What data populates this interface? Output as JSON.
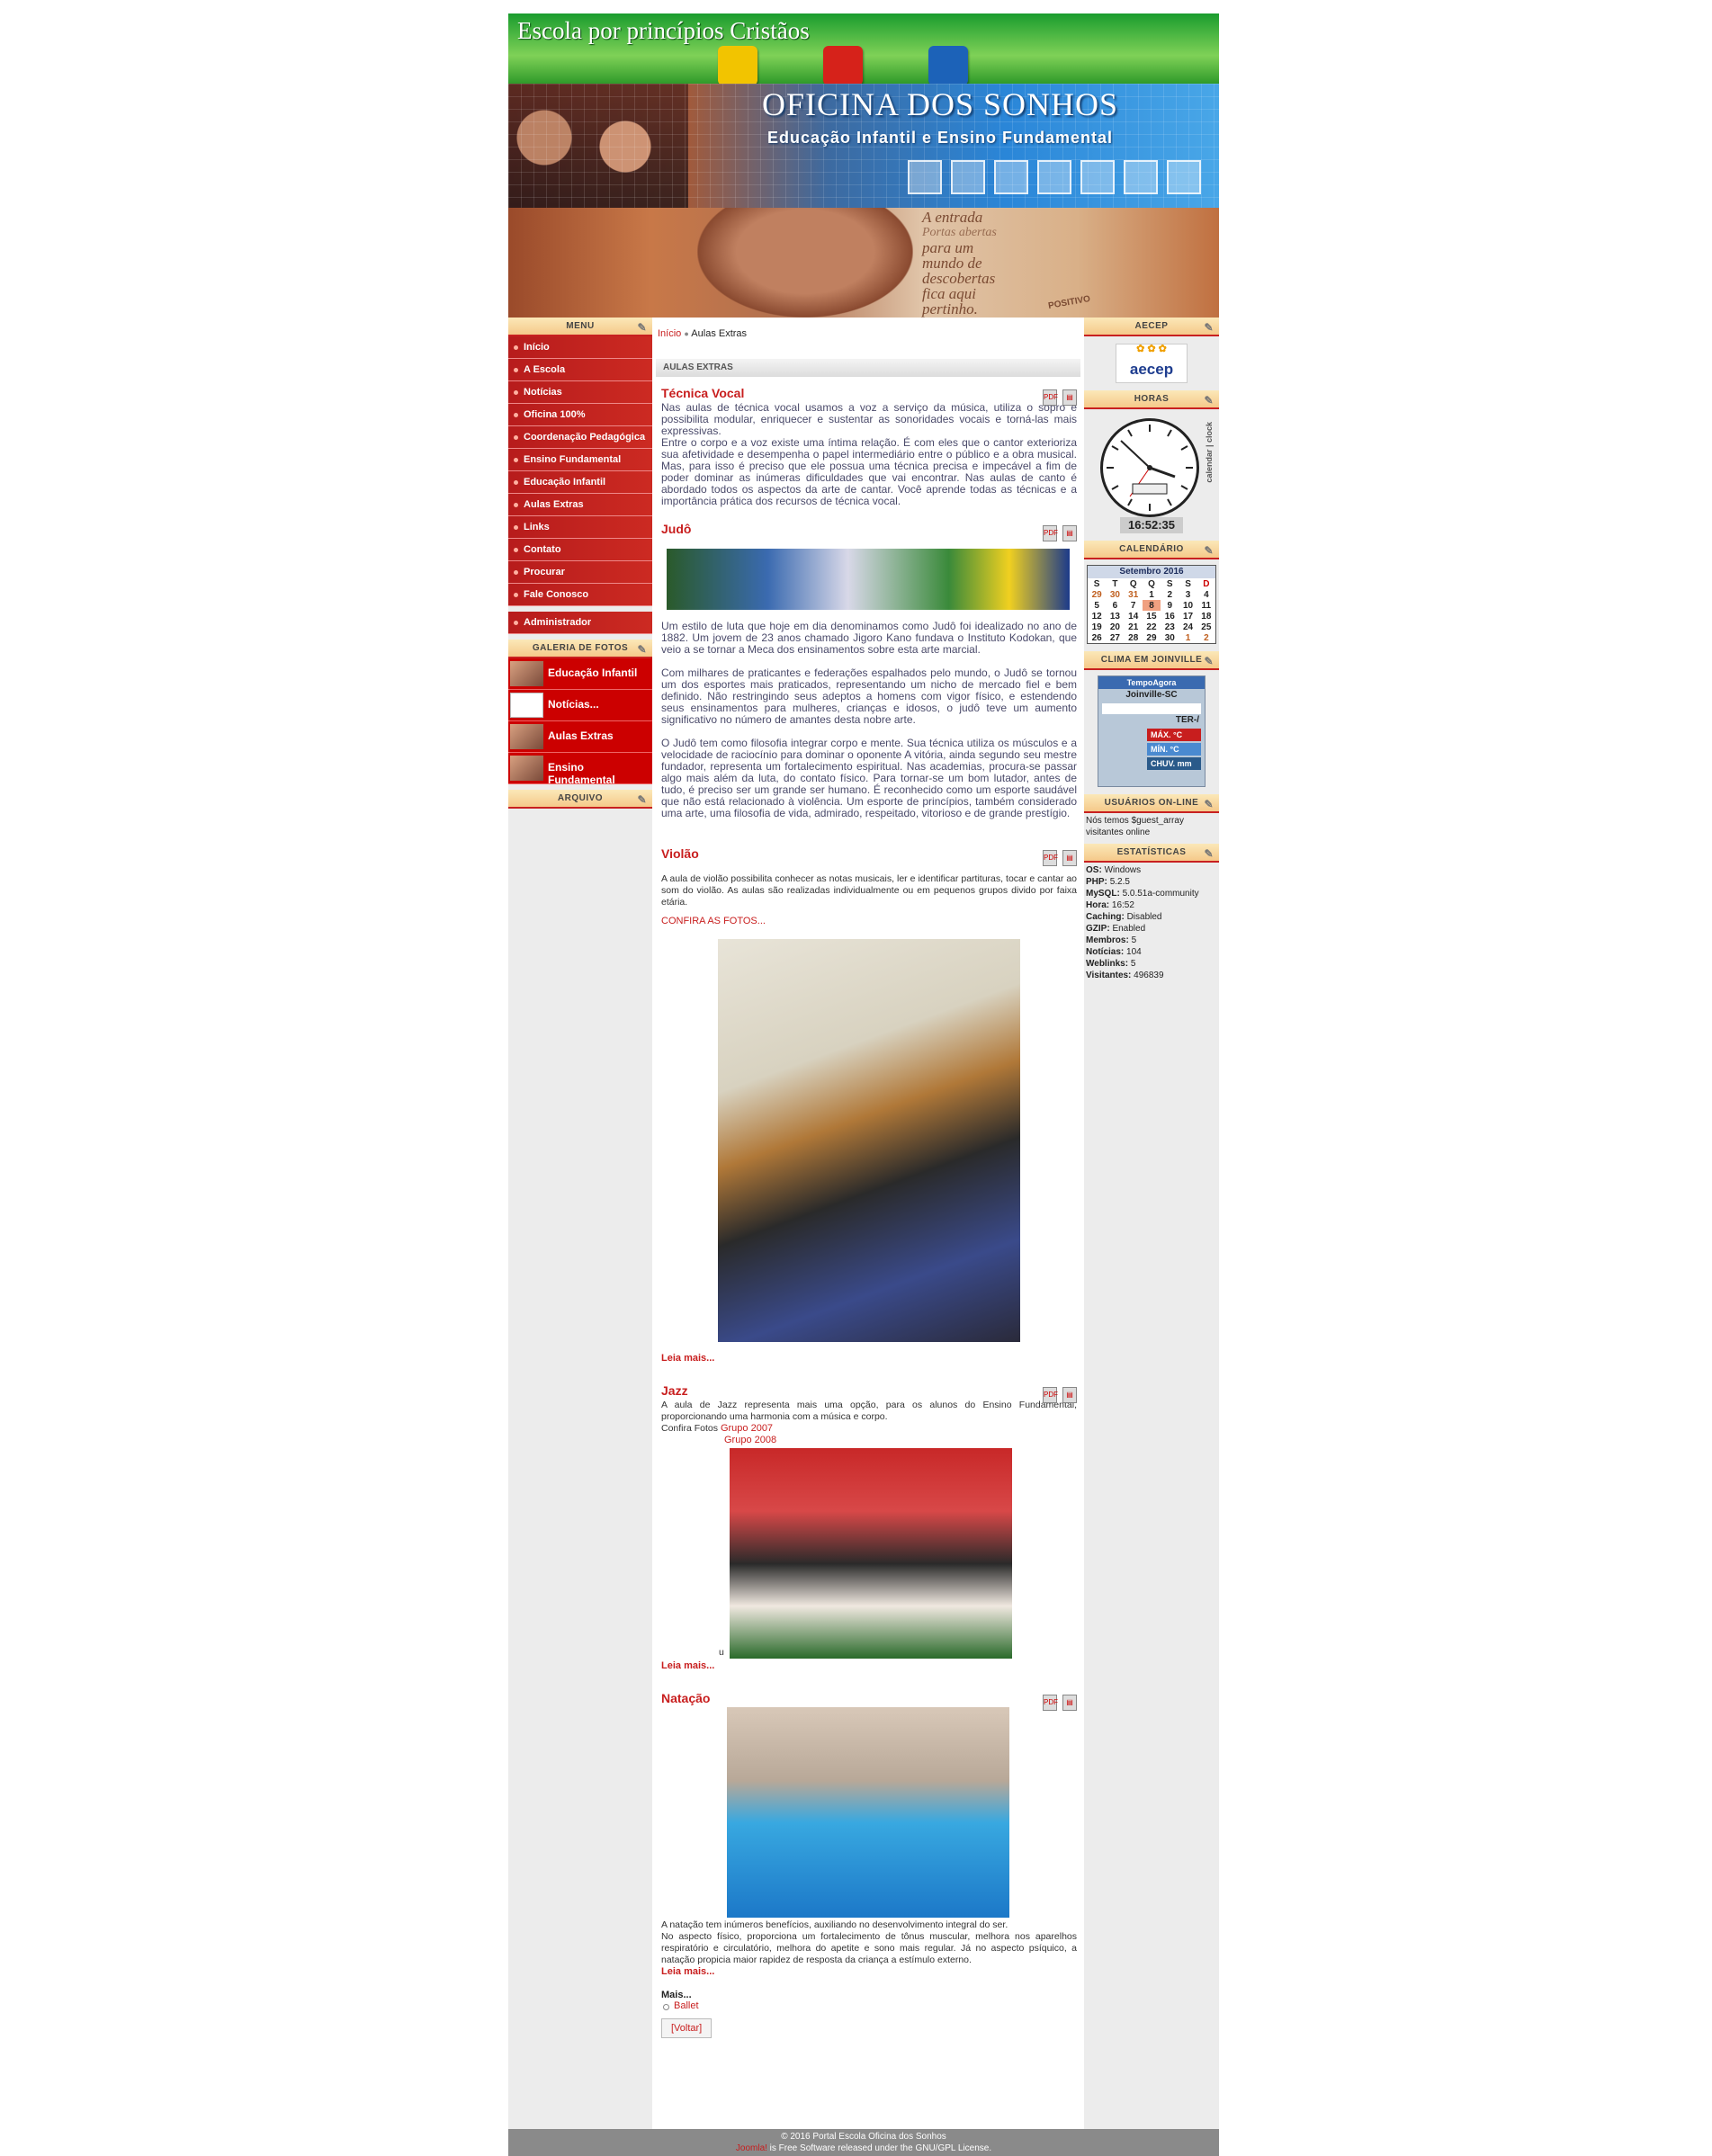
{
  "header": {
    "tagline": "Escola por princípios Cristãos",
    "title": "OFICINA DOS SONHOS",
    "subtitle": "Educação Infantil e Ensino Fundamental",
    "quote_lines": [
      "A entrada",
      "Portas abertas",
      "para um",
      "mundo de",
      "descobertas",
      "fica aqui",
      "pertinho."
    ],
    "positivo": "POSITIVO",
    "icon_colors": [
      "#f2c400",
      "#d6221a",
      "#1c62b8"
    ]
  },
  "menu": {
    "heading": "MENU",
    "items": [
      "Início",
      "A Escola",
      "Notícias",
      "Oficina 100%",
      "Coordenação Pedagógica",
      "Ensino Fundamental",
      "Educação Infantil",
      "Aulas Extras",
      "Links",
      "Contato",
      "Procurar",
      "Fale Conosco"
    ],
    "admin": "Administrador"
  },
  "gallery": {
    "heading": "GALERIA DE FOTOS",
    "items": [
      "Educação Infantil",
      "Notícias...",
      "Aulas Extras",
      "Ensino Fundamental"
    ]
  },
  "archive": {
    "heading": "ARQUIVO"
  },
  "breadcrumb": {
    "home": "Início",
    "current": "Aulas Extras"
  },
  "section_heading": "AULAS EXTRAS",
  "articles": {
    "tecnica": {
      "title": "Técnica Vocal",
      "p1": "Nas aulas de técnica vocal usamos a voz a serviço da música, utiliza o sopro e possibilita modular, enriquecer e sustentar as sonoridades vocais e torná-las mais expressivas.",
      "p2": "Entre o corpo e a voz existe uma íntima relação. É com eles que o cantor exterioriza sua afetividade e desempenha o papel intermediário entre o público e a obra musical. Mas, para isso é preciso que ele possua uma técnica precisa e impecável a fim de poder dominar as inúmeras dificuldades que vai encontrar. Nas aulas de canto é abordado todos os aspectos da arte de cantar. Você aprende todas as técnicas e a importância prática dos recursos de técnica vocal."
    },
    "judo": {
      "title": "Judô",
      "p1": "Um estilo de luta que hoje em dia denominamos como Judô foi idealizado no ano de 1882. Um jovem de 23 anos chamado Jigoro Kano fundava o Instituto Kodokan, que veio a se tornar a Meca dos ensinamentos sobre esta arte marcial.",
      "p2": "Com milhares de praticantes e federações espalhados pelo mundo, o Judô se tornou um dos esportes mais praticados, representando um nicho de mercado fiel e bem definido. Não restringindo seus adeptos a homens com vigor físico, e estendendo seus ensinamentos para mulheres, crianças e idosos, o judô teve um aumento significativo no número de amantes desta nobre arte.",
      "p3": "O Judô tem como filosofia integrar corpo e mente. Sua técnica utiliza os músculos e a velocidade de raciocínio para dominar o oponente A vitória, ainda segundo seu mestre fundador, representa um fortalecimento espiritual. Nas academias, procura-se passar algo mais além da luta, do contato físico. Para tornar-se um bom lutador, antes de tudo, é preciso ser um grande ser humano. É reconhecido como um esporte saudável que não está relacionado à violência. Um esporte de princípios, também considerado uma arte, uma filosofia de vida, admirado, respeitado, vitorioso e de grande prestígio."
    },
    "violao": {
      "title": "Violão",
      "p1": "A aula de violão possibilita conhecer as notas musicais, ler e identificar partituras, tocar e cantar ao som do violão. As aulas são realizadas individualmente ou em pequenos grupos divido por faixa etária.",
      "confira": "CONFIRA AS FOTOS...",
      "leia": "Leia mais..."
    },
    "jazz": {
      "title": "Jazz",
      "p1": "A aula de Jazz representa mais uma opção, para os alunos do Ensino Fundamental, proporcionando uma harmonia com a música e corpo.",
      "confira": "Confira  Fotos",
      "link1": "Grupo 2007",
      "link2": "Grupo 2008",
      "stray": "u",
      "leia": "Leia mais..."
    },
    "natacao": {
      "title": "Natação",
      "p1": "A natação tem inúmeros benefícios, auxiliando no desenvolvimento integral do ser.",
      "p2": "No aspecto físico, proporciona um fortalecimento de tônus muscular, melhora nos aparelhos respiratório e circulatório, melhora do apetite e sono mais regular. Já no aspecto psíquico, a natação propicia maior rapidez de resposta da criança a estímulo externo.",
      "leia": "Leia mais..."
    }
  },
  "more": {
    "heading": "Mais...",
    "items": [
      "Ballet"
    ],
    "back": "[Voltar]"
  },
  "right": {
    "aecep_heading": "AECEP",
    "aecep_logo": "aecep",
    "horas_heading": "HORAS",
    "clock_time": "16:52:35",
    "clock_side": "calendar | clock",
    "calendar_heading": "CALENDÁRIO",
    "calendar_month": "Setembro 2016",
    "weekdays": [
      "S",
      "T",
      "Q",
      "Q",
      "S",
      "S",
      "D"
    ],
    "weeks": [
      [
        "29",
        "30",
        "31",
        "1",
        "2",
        "3",
        "4"
      ],
      [
        "5",
        "6",
        "7",
        "8",
        "9",
        "10",
        "11"
      ],
      [
        "12",
        "13",
        "14",
        "15",
        "16",
        "17",
        "18"
      ],
      [
        "19",
        "20",
        "21",
        "22",
        "23",
        "24",
        "25"
      ],
      [
        "26",
        "27",
        "28",
        "29",
        "30",
        "1",
        "2"
      ]
    ],
    "today": "8",
    "weather_heading": "CLIMA EM JOINVILLE",
    "weather_brand": "TempoAgora",
    "weather_city": "Joinville-SC",
    "weather_day": "TER-/",
    "weather_max": "MÁX.    °C",
    "weather_min": "MÍN.    °C",
    "weather_chuv": "CHUV.   mm",
    "online_heading": "USUÁRIOS ON-LINE",
    "online_text": "Nós temos $guest_array visitantes online",
    "stats_heading": "ESTATÍSTICAS",
    "stats": [
      {
        "k": "OS:",
        "v": "Windows"
      },
      {
        "k": "PHP:",
        "v": "5.2.5"
      },
      {
        "k": "MySQL:",
        "v": "5.0.51a-community"
      },
      {
        "k": "Hora:",
        "v": "16:52"
      },
      {
        "k": "Caching:",
        "v": "Disabled"
      },
      {
        "k": "GZIP:",
        "v": "Enabled"
      },
      {
        "k": "Membros:",
        "v": "5"
      },
      {
        "k": "Notícias:",
        "v": "104"
      },
      {
        "k": "Weblinks:",
        "v": "5"
      },
      {
        "k": "Visitantes:",
        "v": "496839"
      }
    ]
  },
  "footer": {
    "line1": "© 2016 Portal Escola Oficina dos Sonhos",
    "joomla": "Joomla!",
    "line2": " is Free Software released under the GNU/GPL License."
  }
}
